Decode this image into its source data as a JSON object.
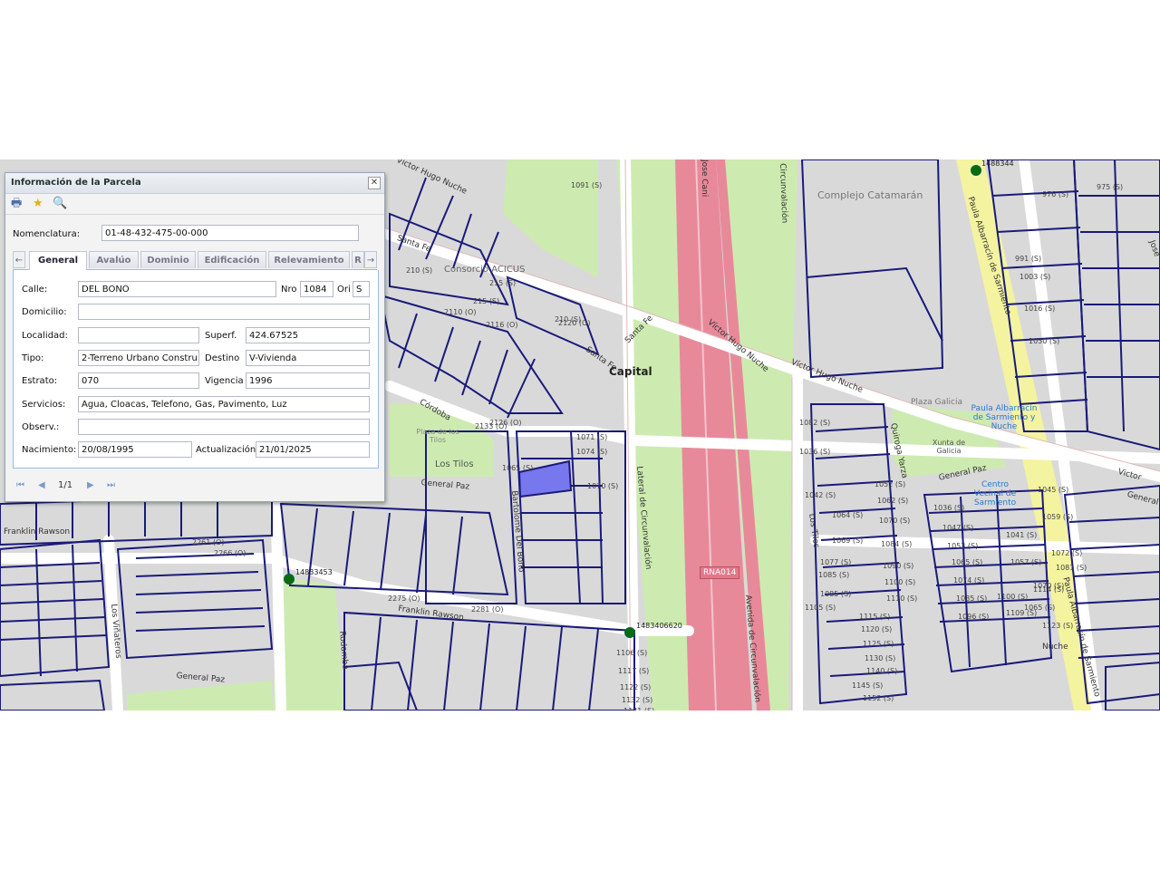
{
  "dialog": {
    "title": "Información de la Parcela",
    "close": "✕",
    "toolbar": {
      "print": "🖶",
      "favorite": "★",
      "zoom": "🔍"
    },
    "nomenclatura_label": "Nomenclatura:",
    "nomenclatura_value": "01-48-432-475-00-000",
    "tabs": [
      "General",
      "Avalúo",
      "Dominio",
      "Edificación",
      "Relevamiento",
      "R"
    ],
    "tab_prev": "←",
    "tab_next": "→",
    "fields": {
      "calle_label": "Calle:",
      "calle_value": "DEL BONO",
      "nro_label": "Nro",
      "nro_value": "1084",
      "ori_label": "Ori",
      "ori_value": "S",
      "domicilio_label": "Domicilio:",
      "domicilio_value": "",
      "localidad_label": "Localidad:",
      "localidad_value": "",
      "superf_label": "Superf.",
      "superf_value": "424.67525",
      "tipo_label": "Tipo:",
      "tipo_value": "2-Terreno Urbano Constru",
      "destino_label": "Destino",
      "destino_value": "V-Vivienda",
      "estrato_label": "Estrato:",
      "estrato_value": "070",
      "vigencia_label": "Vigencia",
      "vigencia_value": "1996",
      "servicios_label": "Servicios:",
      "servicios_value": "Agua, Cloacas, Telefono, Gas, Pavimento, Luz",
      "observ_label": "Observ.:",
      "observ_value": "",
      "nacimiento_label": "Nacimiento:",
      "nacimiento_value": "20/08/1995",
      "actualizacion_label": "Actualización",
      "actualizacion_value": "21/01/2025"
    },
    "pager": {
      "first": "⏮",
      "prev": "◀",
      "page": "1/1",
      "next": "▶",
      "last": "⏭"
    }
  },
  "map": {
    "labels": {
      "capital": "Capital",
      "complejo": "Complejo Catamarán",
      "plaza_galicia": "Plaza Galicia",
      "xunta": "Xunta de Galicia",
      "plaza_los_tilos": "Plaza de los Tilos",
      "los_tilos_park": "Los Tilos",
      "consorcio": "Consorcio ACICUS",
      "paula_poi": "Paula Albarracín de Sarmiento y Nuche",
      "centro": "Centro Vecinal de Sarmiento"
    },
    "roads": {
      "victor1": "Víctor Hugo Nuche",
      "victor2": "Víctor Hugo Nuche",
      "victor3": "Víctor Hugo Nuche",
      "victor4": "Víctor Hugo Nuche",
      "victor5": "Victor",
      "santa_fe1": "Santa Fe",
      "santa_fe2": "Santa Fe",
      "santa_fe3": "Santa Fe",
      "cordoba": "Córdoba",
      "general_paz1": "General Paz",
      "general_paz2": "General Paz",
      "general_paz3": "General Paz",
      "general_paz4": "General",
      "bartolome": "Bartolomé Del Bono",
      "lateral": "Lateral de Circunvalación",
      "avenida": "Avenida de Circunvalación",
      "circunvalacion": "Circunvalación",
      "los_tilos": "Los Tilos",
      "quiroga": "Quiroga Yarza",
      "franklin1": "Franklin Rawson",
      "franklin2": "Franklin Rawson",
      "los_vinateros": "Los Viñateros",
      "redamba": "Rodamba",
      "paula1": "Paula Albarracín de Sarmiento",
      "paula2": "Paula Albarracín de Sarmiento",
      "nuche": "Nuche",
      "camino": "Jose Cani",
      "jose_ingenieros": "José"
    },
    "shield": "RNA014",
    "markers": [
      "1488344",
      "14833453",
      "1483406620"
    ],
    "parcel_numbers": [
      "1091 (S)",
      "210 (S)",
      "215 (S)",
      "210 (S)",
      "215 (S)",
      "1071 (S)",
      "1074 (S)",
      "1065 (S)",
      "1070 (S)",
      "1082 (S)",
      "1036 (S)",
      "1042 (S)",
      "1064 (S)",
      "1069 (S)",
      "1077 (S)",
      "1085 (S)",
      "1085 (S)",
      "1105 (S)",
      "1052 (S)",
      "1062 (S)",
      "1070 (S)",
      "1084 (S)",
      "1090 (S)",
      "1100 (S)",
      "1110 (S)",
      "1115 (S)",
      "1120 (S)",
      "1125 (S)",
      "1130 (S)",
      "1140 (S)",
      "1145 (S)",
      "1152 (S)",
      "1106 (S)",
      "1117 (S)",
      "1122 (S)",
      "1132 (S)",
      "1141 (S)",
      "2261 (O)",
      "2266 (O)",
      "2275 (O)",
      "2281 (O)",
      "1036 (S)",
      "1047 (S)",
      "1053 (S)",
      "1065 (S)",
      "1074 (S)",
      "1085 (S)",
      "1096 (S)",
      "1100 (S)",
      "1109 (S)",
      "1114 (S)",
      "1123 (S)",
      "1041 (S)",
      "1057 (S)",
      "1045 (S)",
      "1059 (S)",
      "1072 (S)",
      "1081 (S)",
      "1070 (S)",
      "1065 (S)",
      "976 (S)",
      "2126 (O)",
      "2133 (O)",
      "2110 (O)",
      "2116 (O)",
      "2120 (O)",
      "975 (S)",
      "991 (S)",
      "1003 (S)",
      "1016 (S)",
      "1030 (S)"
    ]
  }
}
